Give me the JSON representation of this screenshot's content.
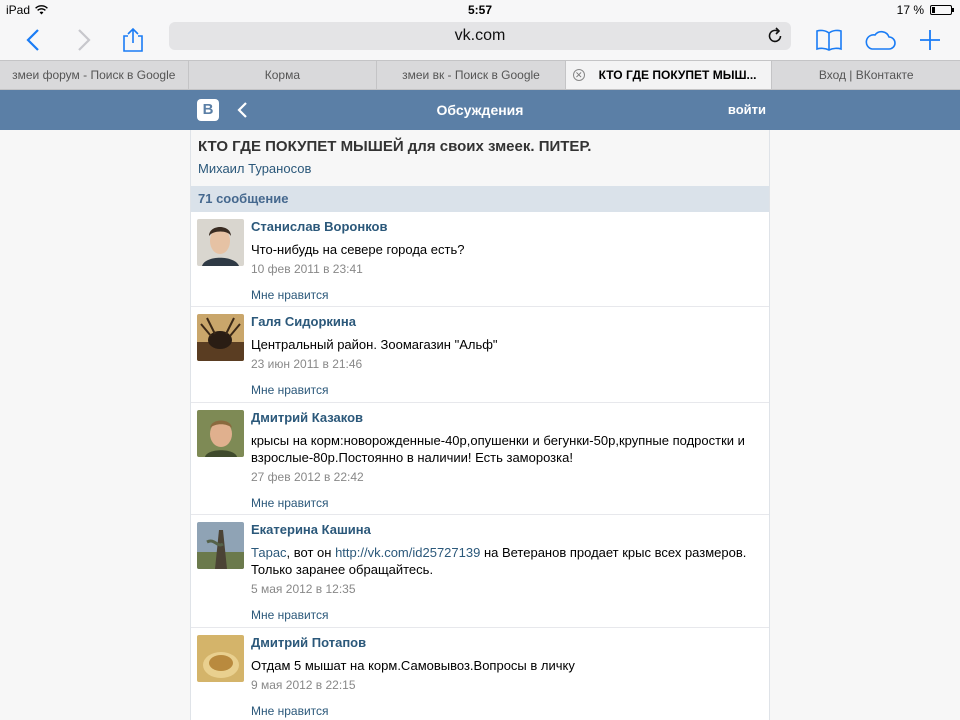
{
  "status": {
    "device": "iPad",
    "time": "5:57",
    "battery": "17 %",
    "battery_level": 0.17,
    "icons": [
      "wifi-icon",
      "battery-icon"
    ]
  },
  "toolbar": {
    "url": "vk.com",
    "icons": [
      "back-icon",
      "forward-icon",
      "share-icon",
      "reload-icon",
      "bookmarks-icon",
      "icloud-tabs-icon",
      "new-tab-icon"
    ]
  },
  "tabs": [
    {
      "label": "змеи форум - Поиск в Google",
      "active": false
    },
    {
      "label": "Корма",
      "active": false
    },
    {
      "label": "змеи вк - Поиск в Google",
      "active": false
    },
    {
      "label": "КТО ГДЕ ПОКУПЕТ МЫШ...",
      "active": true
    },
    {
      "label": "Вход | ВКонтакте",
      "active": false
    }
  ],
  "vk": {
    "logo": "B",
    "title": "Обсуждения",
    "login": "войти",
    "accent": "#5b7fa6"
  },
  "topic": {
    "title": "КТО ГДЕ ПОКУПЕТ МЫШЕЙ для своих змеек. ПИТЕР.",
    "author": "Михаил Тураносов",
    "count": "71 сообщение"
  },
  "posts": [
    {
      "author": "Станислав Воронков",
      "text": "Что-нибудь на севере города есть?",
      "date": "10 фев 2011 в 23:41",
      "like": "Мне нравится"
    },
    {
      "author": "Галя Сидоркина",
      "text": "Центральный район. Зоомагазин \"Альф\"",
      "date": "23 июн 2011 в 21:46",
      "like": "Мне нравится"
    },
    {
      "author": "Дмитрий Казаков",
      "text": "крысы на корм:новорожденные-40р,опушенки и бегунки-50р,крупные подростки и взрослые-80р.Постоянно в наличии! Есть заморозка!",
      "date": "27 фев 2012 в 22:42",
      "like": "Мне нравится"
    },
    {
      "author": "Екатерина Кашина",
      "mention": "Тарас",
      "text_a": ", вот он ",
      "link": "http://vk.com/id25727139",
      "text_b": " на Ветеранов продает крыс всех размеров. Только заранее обращайтесь.",
      "date": "5 мая 2012 в 12:35",
      "like": "Мне нравится"
    },
    {
      "author": "Дмитрий Потапов",
      "text": "Отдам 5 мышат на корм.Самовывоз.Вопросы в личку",
      "date": "9 мая 2012 в 22:15",
      "like": "Мне нравится"
    }
  ]
}
